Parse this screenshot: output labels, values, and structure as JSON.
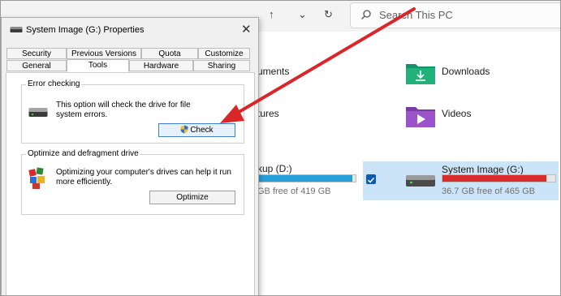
{
  "explorer": {
    "nav": {
      "up_label": "↑",
      "dropdown_label": "⌄",
      "refresh_label": "↻"
    },
    "search": {
      "placeholder": "Search This PC"
    },
    "folders": [
      {
        "label": "uments",
        "color": "#2f73d8"
      },
      {
        "label": "Downloads",
        "color": "#1aa36a"
      },
      {
        "label": "tures",
        "color": "#c2a43a"
      },
      {
        "label": "Videos",
        "color": "#8b3fb8"
      }
    ],
    "drives": [
      {
        "label": "kup (D:)",
        "sub": "GB free of 419 GB",
        "usage": 0.97,
        "fill": "#26a0da"
      },
      {
        "label": "System Image (G:)",
        "sub": "36.7 GB free of 465 GB",
        "usage": 0.92,
        "fill": "#da2c2c",
        "selected": true
      }
    ]
  },
  "dialog": {
    "title": "System Image (G:) Properties",
    "close_label": "✕",
    "tabs_row1": [
      "Security",
      "Previous Versions",
      "Quota",
      "Customize"
    ],
    "tabs_row2": [
      "General",
      "Tools",
      "Hardware",
      "Sharing"
    ],
    "active_tab": "Tools",
    "error_checking": {
      "title": "Error checking",
      "text_line1": "This option will check the drive for file",
      "text_line2": "system errors.",
      "button_label": "Check"
    },
    "optimize": {
      "title": "Optimize and defragment drive",
      "text_line1": "Optimizing your computer's drives can help it run",
      "text_line2": "more efficiently.",
      "button_label": "Optimize"
    }
  },
  "annotation": {
    "arrow_color": "#d8262b"
  }
}
